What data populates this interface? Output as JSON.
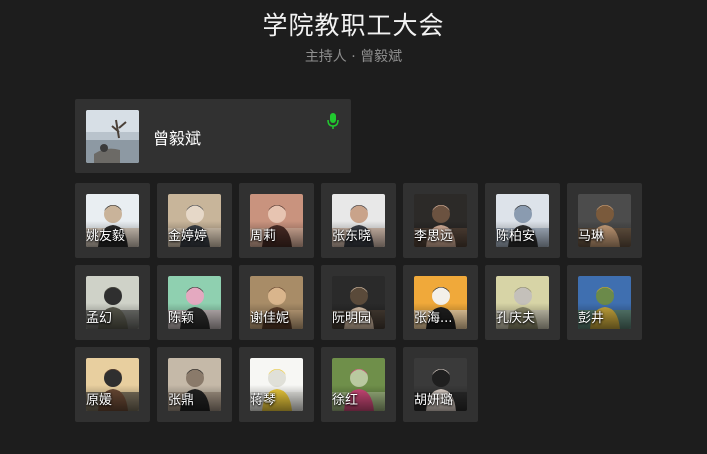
{
  "meeting": {
    "title": "学院教职工大会",
    "host_line": "主持人 · 曾毅斌"
  },
  "host": {
    "name": "曾毅斌",
    "mic_icon": "microphone-icon",
    "mic_color": "#21c92f"
  },
  "participants": [
    {
      "name": "姚友毅",
      "colors": [
        "#e9eef2",
        "#2a2a2a",
        "#c9b39a"
      ]
    },
    {
      "name": "金婷婷",
      "colors": [
        "#c8b59a",
        "#3a3f46",
        "#e6d8c8"
      ]
    },
    {
      "name": "周莉",
      "colors": [
        "#c9937e",
        "#4b2d26",
        "#e7c4b1"
      ]
    },
    {
      "name": "张东晓",
      "colors": [
        "#e8e8e8",
        "#3b3f47",
        "#c9a38a"
      ]
    },
    {
      "name": "李思远",
      "colors": [
        "#2c2a28",
        "#d9b39c",
        "#6b5240"
      ]
    },
    {
      "name": "陈柏安",
      "colors": [
        "#dde3ea",
        "#2e2e2e",
        "#8a9bb0"
      ]
    },
    {
      "name": "马琳",
      "colors": [
        "#4c4c4c",
        "#caa07a",
        "#7a5a3c"
      ]
    },
    {
      "name": "孟幻",
      "colors": [
        "#cfd2c8",
        "#5a5a4e",
        "#2f2f2f"
      ]
    },
    {
      "name": "陈颖",
      "colors": [
        "#8fd0b0",
        "#2c2c2c",
        "#e4a9c0"
      ]
    },
    {
      "name": "谢佳妮",
      "colors": [
        "#a88c67",
        "#5b3c28",
        "#d9b58c"
      ]
    },
    {
      "name": "阮明园",
      "colors": [
        "#2a2a2a",
        "#d8c0a8",
        "#5a4a3a"
      ]
    },
    {
      "name": "张海...",
      "colors": [
        "#f0a93a",
        "#1f1f1f",
        "#f3f0ea"
      ]
    },
    {
      "name": "孔庆夫",
      "colors": [
        "#d7d4a6",
        "#8c8a6a",
        "#c4c0ba"
      ]
    },
    {
      "name": "彭井",
      "colors": [
        "#3f6fb0",
        "#c9a83c",
        "#6b8a4a"
      ]
    },
    {
      "name": "原媛",
      "colors": [
        "#e8cf9f",
        "#6b4a35",
        "#2f2f2f"
      ]
    },
    {
      "name": "张鼎",
      "colors": [
        "#c5b9a8",
        "#222222",
        "#8a7a6a"
      ]
    },
    {
      "name": "蒋琴",
      "colors": [
        "#f7f7f4",
        "#f2cf3d",
        "#e0e0d8"
      ]
    },
    {
      "name": "徐红",
      "colors": [
        "#6f8f4a",
        "#d04a7a",
        "#b9c9a0"
      ]
    },
    {
      "name": "胡妍璐",
      "colors": [
        "#3a3a3a",
        "#e0d4cc",
        "#1f1f1f"
      ]
    }
  ]
}
